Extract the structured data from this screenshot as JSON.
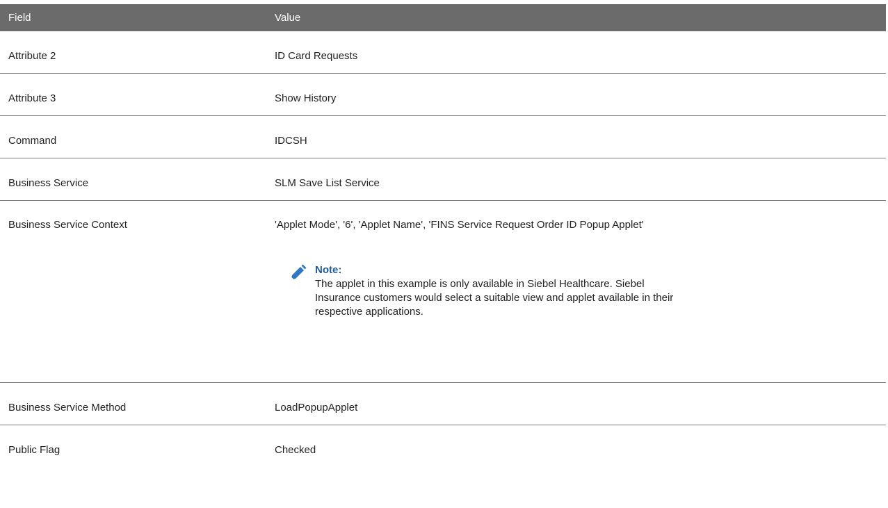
{
  "header": {
    "field": "Field",
    "value": "Value"
  },
  "rows": [
    {
      "field": "Attribute 2",
      "value": "ID Card Requests"
    },
    {
      "field": "Attribute 3",
      "value": "Show History"
    },
    {
      "field": "Command",
      "value": "IDCSH"
    },
    {
      "field": "Business Service",
      "value": "SLM Save List Service"
    },
    {
      "field": "Business Service Context",
      "value": "'Applet Mode', '6', 'Applet Name', 'FINS Service Request Order ID Popup Applet'"
    },
    {
      "field": "Business Service Method",
      "value": "LoadPopupApplet"
    },
    {
      "field": "Public Flag",
      "value": "Checked"
    }
  ],
  "note": {
    "icon": "pencil-icon",
    "title": "Note:",
    "body": "The applet in this example is only available in Siebel Healthcare. Siebel Insurance customers would select a suitable view and applet available in their respective applications."
  },
  "colors": {
    "header_bg": "#6b6b6b",
    "note_title": "#1f5a99",
    "pencil": "#2f77c5"
  }
}
